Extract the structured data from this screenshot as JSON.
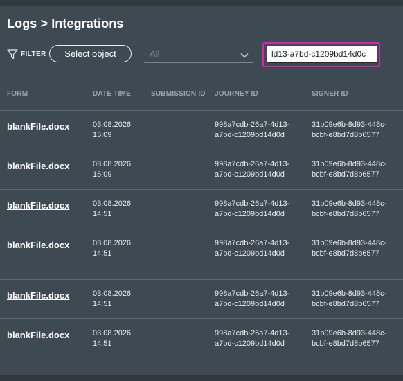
{
  "header": {
    "title": "Logs > Integrations"
  },
  "toolbar": {
    "filter_label": "FILTER",
    "select_object_label": "Select object",
    "dropdown_value": "All",
    "search_value": "ld13-a7bd-c1209bd14d0c"
  },
  "table": {
    "columns": [
      "FORM",
      "DATE TIME",
      "SUBMISSION ID",
      "JOURNEY ID",
      "SIGNER ID"
    ],
    "rows": [
      {
        "form": "blankFile.docx",
        "date": "03.08.2026",
        "time": "15:09",
        "submission_id": "",
        "journey_1": "998a7cdb-26a7-4d13-",
        "journey_2": "a7bd-c1209bd14d0d",
        "signer_1": "31b09e6b-8d93-448c-",
        "signer_2": "bcbf-e8bd7d8b6577"
      },
      {
        "form": "blankFile.docx",
        "date": "03.08.2026",
        "time": "15:09",
        "submission_id": "",
        "journey_1": "998a7cdb-26a7-4d13-",
        "journey_2": "a7bd-c1209bd14d0d",
        "signer_1": "31b09e6b-8d93-448c-",
        "signer_2": "bcbf-e8bd7d8b6577"
      },
      {
        "form": "blankFile.docx",
        "date": "03.08.2026",
        "time": "14:51",
        "submission_id": "",
        "journey_1": "998a7cdb-26a7-4d13-",
        "journey_2": "a7bd-c1209bd14d0d",
        "signer_1": "31b09e6b-8d93-448c-",
        "signer_2": "bcbf-e8bd7d8b6577"
      },
      {
        "form": "blankFile.docx",
        "date": "03.08.2026",
        "time": "14:51",
        "submission_id": "",
        "journey_1": "998a7cdb-26a7-4d13-",
        "journey_2": "a7bd-c1209bd14d0d",
        "signer_1": "31b09e6b-8d93-448c-",
        "signer_2": "bcbf-e8bd7d8b6577"
      },
      {
        "form": "blankFile.docx",
        "date": "03.08.2026",
        "time": "14:51",
        "submission_id": "",
        "journey_1": "998a7cdb-26a7-4d13-",
        "journey_2": "a7bd-c1209bd14d0d",
        "signer_1": "31b09e6b-8d93-448c-",
        "signer_2": "bcbf-e8bd7d8b6577"
      },
      {
        "form": "blankFile.docx",
        "date": "03.08.2026",
        "time": "14:51",
        "submission_id": "",
        "journey_1": "998a7cdb-26a7-4d13-",
        "journey_2": "a7bd-c1209bd14d0d",
        "signer_1": "31b09e6b-8d93-448c-",
        "signer_2": "bcbf-e8bd7d8b6577"
      }
    ]
  },
  "colors": {
    "background": "#3e4a52",
    "highlight": "#e020b0"
  },
  "icons": {
    "filter": "funnel-icon",
    "dropdown": "chevron-down-icon"
  }
}
